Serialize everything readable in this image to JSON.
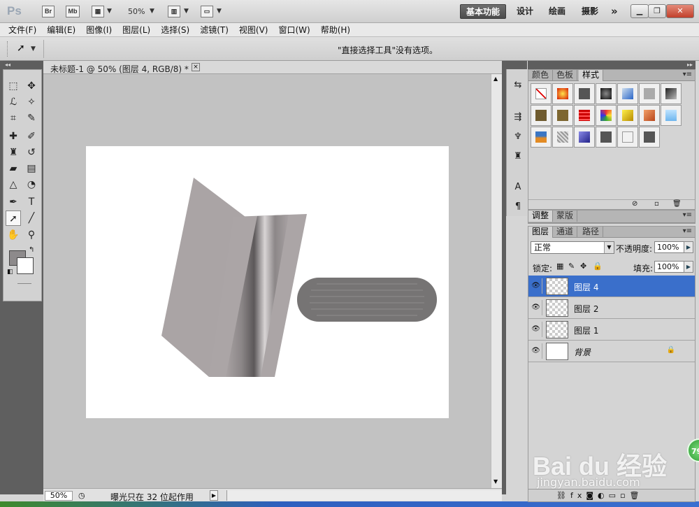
{
  "appbar": {
    "logo": "Ps",
    "bridge": "Br",
    "minibridge": "Mb",
    "zoom": "50%",
    "workspaces": [
      "基本功能",
      "设计",
      "绘画",
      "摄影"
    ],
    "more": "»"
  },
  "menu": [
    "文件(F)",
    "编辑(E)",
    "图像(I)",
    "图层(L)",
    "选择(S)",
    "滤镜(T)",
    "视图(V)",
    "窗口(W)",
    "帮助(H)"
  ],
  "options": {
    "hint": "\"直接选择工具\"没有选项。"
  },
  "document": {
    "tab_title": "未标题-1 @ 50% (图层 4, RGB/8) *",
    "close": "×",
    "bg_color": "#ffffff"
  },
  "status": {
    "zoom": "50%",
    "text": "曝光只在 32 位起作用"
  },
  "colors": {
    "foreground": "#8d8a8b",
    "background": "#ffffff",
    "selection": "#3a6fcb"
  },
  "panels": {
    "styles_tabs": [
      "颜色",
      "色板",
      "样式"
    ],
    "adjust_tabs": [
      "调整",
      "蒙版"
    ],
    "layer_tabs": [
      "图层",
      "通道",
      "路径"
    ]
  },
  "layers": {
    "blend_mode": "正常",
    "opacity_label": "不透明度:",
    "opacity": "100%",
    "lock_label": "锁定:",
    "fill_label": "填充:",
    "fill": "100%",
    "items": [
      {
        "name": "图层 4",
        "selected": true
      },
      {
        "name": "图层 2",
        "selected": false
      },
      {
        "name": "图层 1",
        "selected": false
      },
      {
        "name": "背景",
        "selected": false,
        "locked": true
      }
    ]
  },
  "watermark": {
    "logo": "Bai du 经验",
    "url": "jingyan.baidu.com",
    "badge": "79"
  }
}
